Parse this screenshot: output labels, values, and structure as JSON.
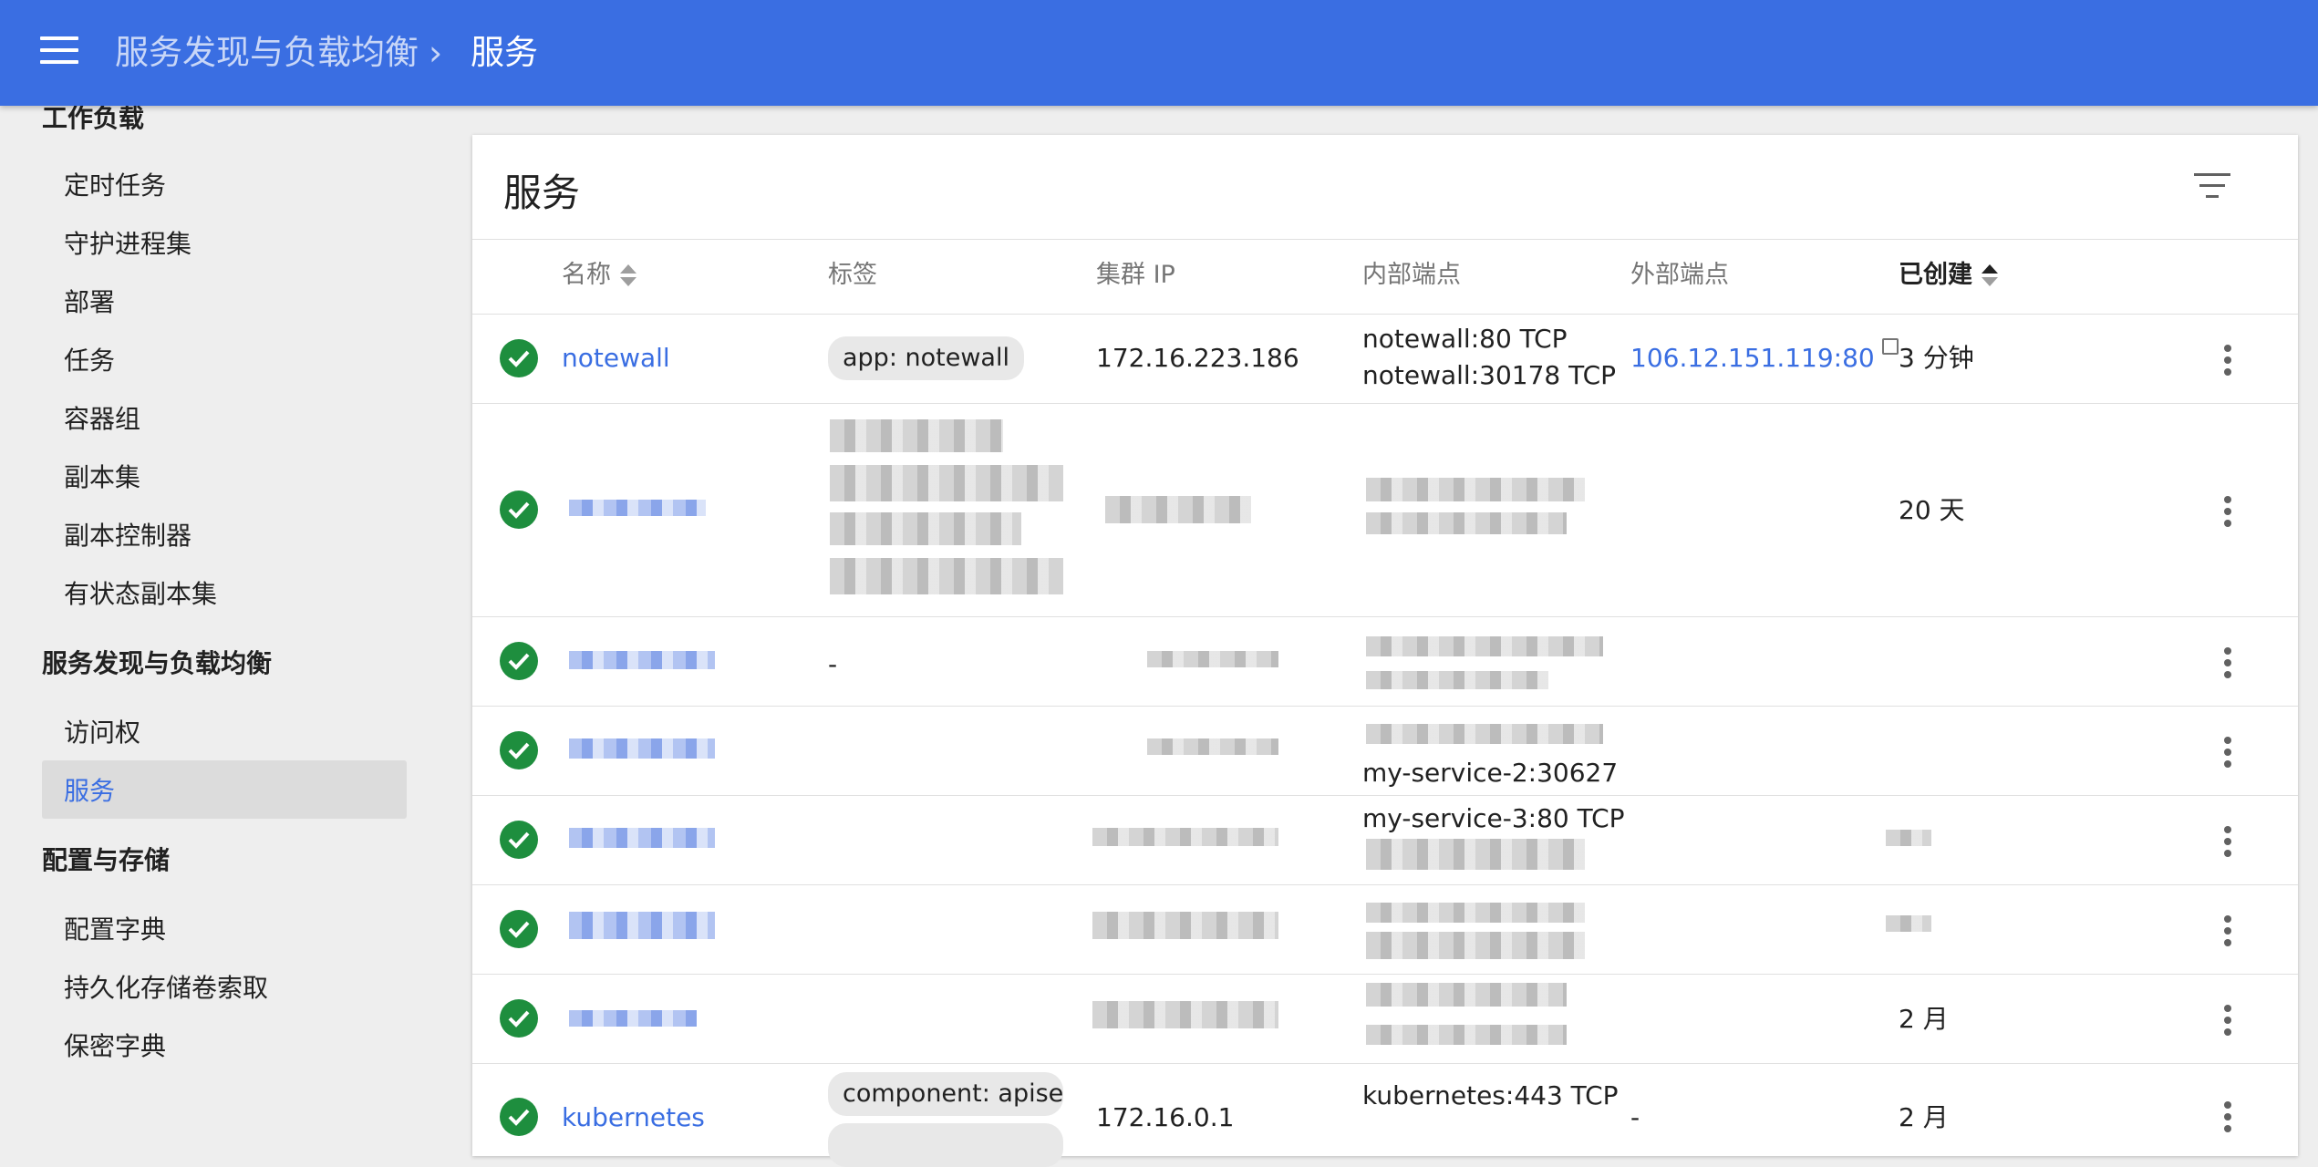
{
  "header": {
    "parent": "服务发现与负载均衡",
    "separator": "›",
    "current": "服务"
  },
  "sidebar": {
    "sections": [
      {
        "title": "工作负载",
        "items": [
          "定时任务",
          "守护进程集",
          "部署",
          "任务",
          "容器组",
          "副本集",
          "副本控制器",
          "有状态副本集"
        ]
      },
      {
        "title": "服务发现与负载均衡",
        "items": [
          "访问权",
          "服务"
        ]
      },
      {
        "title": "配置与存储",
        "items": [
          "配置字典",
          "持久化存储卷索取",
          "保密字典"
        ]
      }
    ],
    "active_item": "服务"
  },
  "card": {
    "title": "服务",
    "columns": {
      "name": "名称",
      "labels": "标签",
      "cluster_ip": "集群 IP",
      "internal_endpoints": "内部端点",
      "external_endpoints": "外部端点",
      "created": "已创建"
    }
  },
  "rows": [
    {
      "name": "notewall",
      "label": "app: notewall",
      "cluster_ip": "172.16.223.186",
      "internal": [
        "notewall:80 TCP",
        "notewall:30178 TCP"
      ],
      "external": "106.12.151.119:80",
      "created": "3 分钟"
    },
    {
      "name": "",
      "label": "",
      "cluster_ip": "",
      "internal": [
        "",
        ""
      ],
      "external": "",
      "created": "20 天"
    },
    {
      "name": "",
      "label": "-",
      "cluster_ip": "",
      "internal": [
        "",
        ""
      ],
      "external": "",
      "created": ""
    },
    {
      "name": "",
      "label": "",
      "cluster_ip": "",
      "internal": [
        "",
        "my-service-2:30627"
      ],
      "external": "",
      "created": ""
    },
    {
      "name": "",
      "label": "",
      "cluster_ip": "",
      "internal": [
        "my-service-3:80 TCP",
        ""
      ],
      "external": "",
      "created": ""
    },
    {
      "name": "",
      "label": "",
      "cluster_ip": "",
      "internal": [
        "",
        ""
      ],
      "external": "",
      "created": ""
    },
    {
      "name": "",
      "label": "",
      "cluster_ip": "",
      "internal": [
        "",
        ""
      ],
      "external": "",
      "created": "2 月"
    },
    {
      "name": "kubernetes",
      "label": "component: apiser.",
      "cluster_ip": "172.16.0.1",
      "internal": [
        "kubernetes:443 TCP",
        ""
      ],
      "external": "-",
      "created": "2 月"
    }
  ]
}
